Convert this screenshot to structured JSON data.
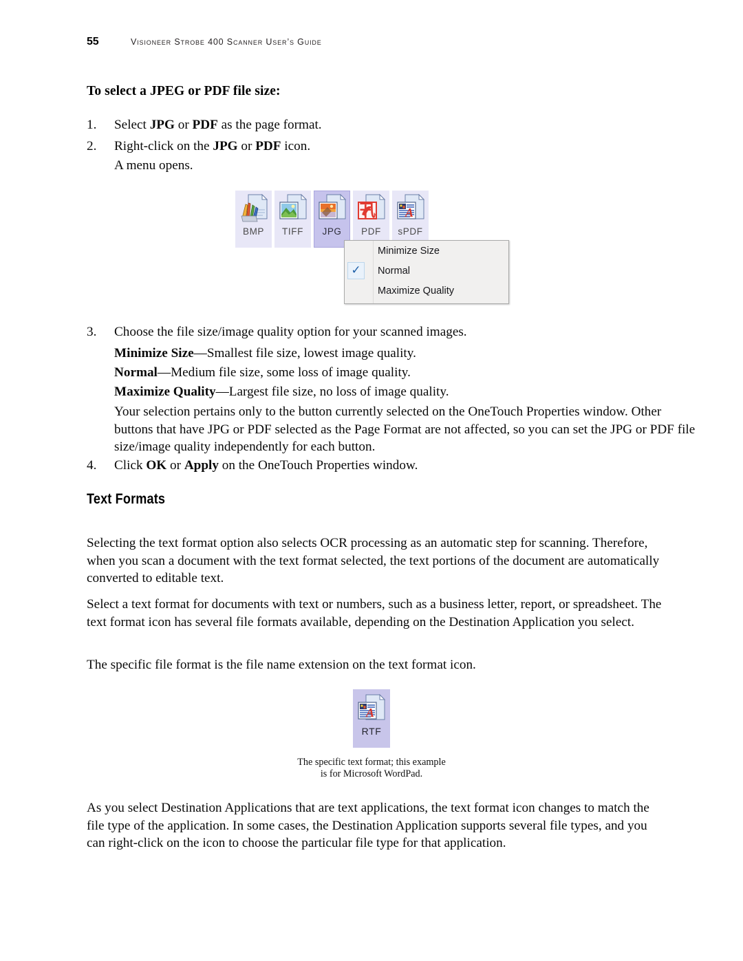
{
  "header": {
    "page_number": "55",
    "title": "Visioneer Strobe 400 Scanner User’s Guide"
  },
  "sections": {
    "jpeg_pdf_heading": "To select a JPEG or PDF file size:",
    "step1_num": "1.",
    "step1_text_a": "Select ",
    "step1_bold_a": "JPG",
    "step1_text_b": " or ",
    "step1_bold_b": "PDF",
    "step1_text_c": " as the page format.",
    "step2_num": "2.",
    "step2_text_a": "Right-click on the ",
    "step2_bold_a": "JPG",
    "step2_text_b": " or ",
    "step2_bold_b": "PDF",
    "step2_text_c": " icon.",
    "step2_line2": "A menu opens.",
    "step3_num": "3.",
    "step3_text": "Choose the file size/image quality option for your scanned images.",
    "step3_opt1_bold": "Minimize Size",
    "step3_opt1_rest": "—Smallest file size, lowest image quality.",
    "step3_opt2_bold": "Normal",
    "step3_opt2_rest": "—Medium file size, some loss of image quality.",
    "step3_opt3_bold": "Maximize Quality",
    "step3_opt3_rest": "—Largest file size, no loss of image quality.",
    "step3_para": "Your selection pertains only to the button currently selected on the OneTouch Properties window. Other buttons that have JPG or PDF selected as the Page Format are not affected, so you can set the JPG or PDF file size/image quality independently for each button.",
    "step4_num": "4.",
    "step4_text_a": "Click ",
    "step4_bold_a": "OK",
    "step4_text_b": " or ",
    "step4_bold_b": "Apply",
    "step4_text_c": " on the OneTouch Properties window.",
    "text_formats_heading": "Text Formats",
    "text_formats_p1": "Selecting the text format option also selects OCR processing as an automatic step for scanning. Therefore, when you scan a document with the text format selected, the text portions of the document are automatically converted to editable text.",
    "text_formats_p2": "Select a text format for documents with text or numbers, such as a business letter, report, or spreadsheet. The text format icon has several file formats available, depending on the Destination Application you select.",
    "text_formats_p3": "The specific file format is the file name extension on the text format icon.",
    "rtf_caption_line1": "The specific text format; this example",
    "rtf_caption_line2": "is for Microsoft WordPad.",
    "text_formats_p4": "As you select Destination Applications that are text applications, the text format icon changes to match the file type of the application. In some cases, the Destination Application supports several file types, and you can right-click on the icon to choose the particular file type for that application."
  },
  "format_bar": {
    "tiles": [
      {
        "label": "BMP",
        "icon": "bmp-document-icon",
        "selected": false
      },
      {
        "label": "TIFF",
        "icon": "tiff-document-icon",
        "selected": false
      },
      {
        "label": "JPG",
        "icon": "jpg-document-icon",
        "selected": true
      },
      {
        "label": "PDF",
        "icon": "pdf-document-icon",
        "selected": false
      },
      {
        "label": "sPDF",
        "icon": "spdf-document-icon",
        "selected": false
      }
    ]
  },
  "context_menu": {
    "items": [
      {
        "label": "Minimize Size",
        "checked": false
      },
      {
        "label": "Normal",
        "checked": true
      },
      {
        "label": "Maximize Quality",
        "checked": false
      }
    ],
    "check_glyph": "✓"
  },
  "rtf_icon": {
    "label": "RTF",
    "icon": "rtf-document-icon",
    "selected": true
  },
  "colors": {
    "tile_background": "#e8e7f7",
    "tile_selected_background": "#c6c3ec",
    "menu_background": "#f1f0ef",
    "menu_border": "#a9a9a9",
    "check_color": "#1d5fa8",
    "text_color": "#0a0a0a"
  }
}
